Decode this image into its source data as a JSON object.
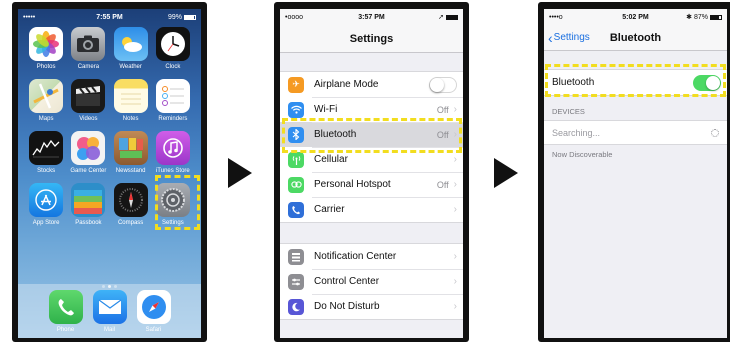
{
  "colors": {
    "highlight": "#f2dd1f",
    "ios_blue": "#1a6fe0",
    "switch_on": "#4cd964",
    "arrow": "#111111"
  },
  "home": {
    "status": {
      "signal": "•••••",
      "time": "7:55 PM",
      "battery": "99%"
    },
    "apps": [
      {
        "label": "Photos",
        "icon": "photos-icon"
      },
      {
        "label": "Camera",
        "icon": "camera-icon"
      },
      {
        "label": "Weather",
        "icon": "weather-icon"
      },
      {
        "label": "Clock",
        "icon": "clock-icon"
      },
      {
        "label": "Maps",
        "icon": "maps-icon"
      },
      {
        "label": "Videos",
        "icon": "videos-icon"
      },
      {
        "label": "Notes",
        "icon": "notes-icon"
      },
      {
        "label": "Reminders",
        "icon": "reminders-icon"
      },
      {
        "label": "Stocks",
        "icon": "stocks-icon"
      },
      {
        "label": "Game Center",
        "icon": "game-center-icon"
      },
      {
        "label": "Newsstand",
        "icon": "newsstand-icon"
      },
      {
        "label": "iTunes Store",
        "icon": "itunes-icon"
      },
      {
        "label": "App Store",
        "icon": "app-store-icon"
      },
      {
        "label": "Passbook",
        "icon": "passbook-icon"
      },
      {
        "label": "Compass",
        "icon": "compass-icon"
      },
      {
        "label": "Settings",
        "icon": "settings-icon"
      }
    ],
    "dock": [
      {
        "label": "Phone",
        "icon": "phone-icon"
      },
      {
        "label": "Mail",
        "icon": "mail-icon"
      },
      {
        "label": "Safari",
        "icon": "safari-icon"
      }
    ]
  },
  "settings": {
    "status": {
      "signal": "•oooo",
      "time": "3:57 PM"
    },
    "title": "Settings",
    "group1": [
      {
        "label": "Airplane Mode",
        "icon": "airplane-icon",
        "toggle": "off"
      },
      {
        "label": "Wi-Fi",
        "icon": "wifi-icon",
        "value": "Off"
      },
      {
        "label": "Bluetooth",
        "icon": "bluetooth-icon",
        "value": "Off",
        "selected": true
      },
      {
        "label": "Cellular",
        "icon": "cellular-icon"
      },
      {
        "label": "Personal Hotspot",
        "icon": "hotspot-icon",
        "value": "Off"
      },
      {
        "label": "Carrier",
        "icon": "carrier-icon"
      }
    ],
    "group2": [
      {
        "label": "Notification Center",
        "icon": "notification-center-icon"
      },
      {
        "label": "Control Center",
        "icon": "control-center-icon"
      },
      {
        "label": "Do Not Disturb",
        "icon": "do-not-disturb-icon"
      }
    ]
  },
  "bluetooth": {
    "status": {
      "signal": "••••o",
      "time": "5:02 PM",
      "battery": "87%"
    },
    "back_label": "Settings",
    "title": "Bluetooth",
    "row_label": "Bluetooth",
    "toggle": "on",
    "devices_header": "DEVICES",
    "searching": "Searching...",
    "discoverable": "Now Discoverable"
  }
}
